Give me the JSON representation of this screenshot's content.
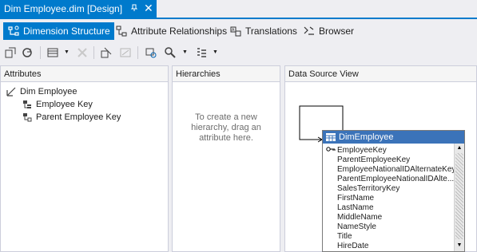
{
  "document_tab": {
    "title": "Dim Employee.dim [Design]",
    "pin": "ㅁ",
    "close": "✕"
  },
  "view_tabs": [
    {
      "label": "Dimension Structure"
    },
    {
      "label": "Attribute Relationships"
    },
    {
      "label": "Translations"
    },
    {
      "label": "Browser"
    }
  ],
  "toolbar": {
    "icons": [
      "process-icon",
      "refresh-icon",
      "show-table-icon",
      "delete-icon",
      "new-attribute-icon",
      "disabled-icon",
      "explore-data-icon",
      "zoom-icon",
      "layout-icon"
    ]
  },
  "attributes_pane": {
    "header": "Attributes",
    "root": "Dim Employee",
    "items": [
      "Employee Key",
      "Parent Employee Key"
    ]
  },
  "hierarchies_pane": {
    "header": "Hierarchies",
    "hint_lines": [
      "To create a new",
      "hierarchy, drag an",
      "attribute here."
    ]
  },
  "dsv_pane": {
    "header": "Data Source View",
    "table": {
      "title": "DimEmployee",
      "columns": [
        "EmployeeKey",
        "ParentEmployeeKey",
        "EmployeeNationalIDAlternateKey",
        "ParentEmployeeNationalIDAlte...",
        "SalesTerritoryKey",
        "FirstName",
        "LastName",
        "MiddleName",
        "NameStyle",
        "Title",
        "HireDate"
      ]
    }
  },
  "colors": {
    "accent": "#007acc",
    "table_title": "#3b73b9"
  }
}
